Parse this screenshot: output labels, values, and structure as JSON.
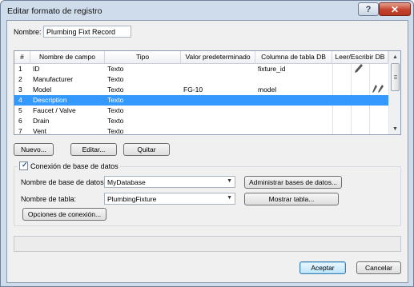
{
  "window": {
    "title": "Editar formato de registro",
    "help_label": "?",
    "close_label": "✕"
  },
  "name": {
    "label": "Nombre:",
    "value": "Plumbing Fixt Record"
  },
  "grid": {
    "columns": [
      "#",
      "Nombre de campo",
      "Tipo",
      "Valor predeterminado",
      "Columna de tabla DB",
      "Leer/Escribir DB"
    ],
    "rows": [
      {
        "num": "1",
        "field": "ID",
        "type": "Texto",
        "default": "",
        "db_column": "fixture_id",
        "icon": "pencil-icon"
      },
      {
        "num": "2",
        "field": "Manufacturer",
        "type": "Texto",
        "default": "",
        "db_column": "",
        "icon": ""
      },
      {
        "num": "3",
        "field": "Model",
        "type": "Texto",
        "default": "FG-10",
        "db_column": "model",
        "icon": "read-write-icon"
      },
      {
        "num": "4",
        "field": "Description",
        "type": "Texto",
        "default": "",
        "db_column": "",
        "icon": ""
      },
      {
        "num": "5",
        "field": "Faucet / Valve",
        "type": "Texto",
        "default": "",
        "db_column": "",
        "icon": ""
      },
      {
        "num": "6",
        "field": "Drain",
        "type": "Texto",
        "default": "",
        "db_column": "",
        "icon": ""
      },
      {
        "num": "7",
        "field": "Vent",
        "type": "Texto",
        "default": "",
        "db_column": "",
        "icon": ""
      }
    ],
    "selected_row": 3
  },
  "buttons": {
    "new": "Nuevo...",
    "edit": "Editar...",
    "remove": "Quitar",
    "manage_db": "Administrar bases de datos...",
    "show_table": "Mostrar tabla...",
    "connection_options": "Opciones de conexión...",
    "accept": "Aceptar",
    "cancel": "Cancelar"
  },
  "db_connection": {
    "checkbox_label": "Conexión de base de datos",
    "checked": true,
    "database_label": "Nombre de base de datos:",
    "database_value": "MyDatabase",
    "table_label": "Nombre de tabla:",
    "table_value": "PlumbingFixture"
  },
  "colors": {
    "selection": "#3399ff",
    "window_frame": "#cfdceb",
    "dialog_bg": "#f0f0f0"
  }
}
